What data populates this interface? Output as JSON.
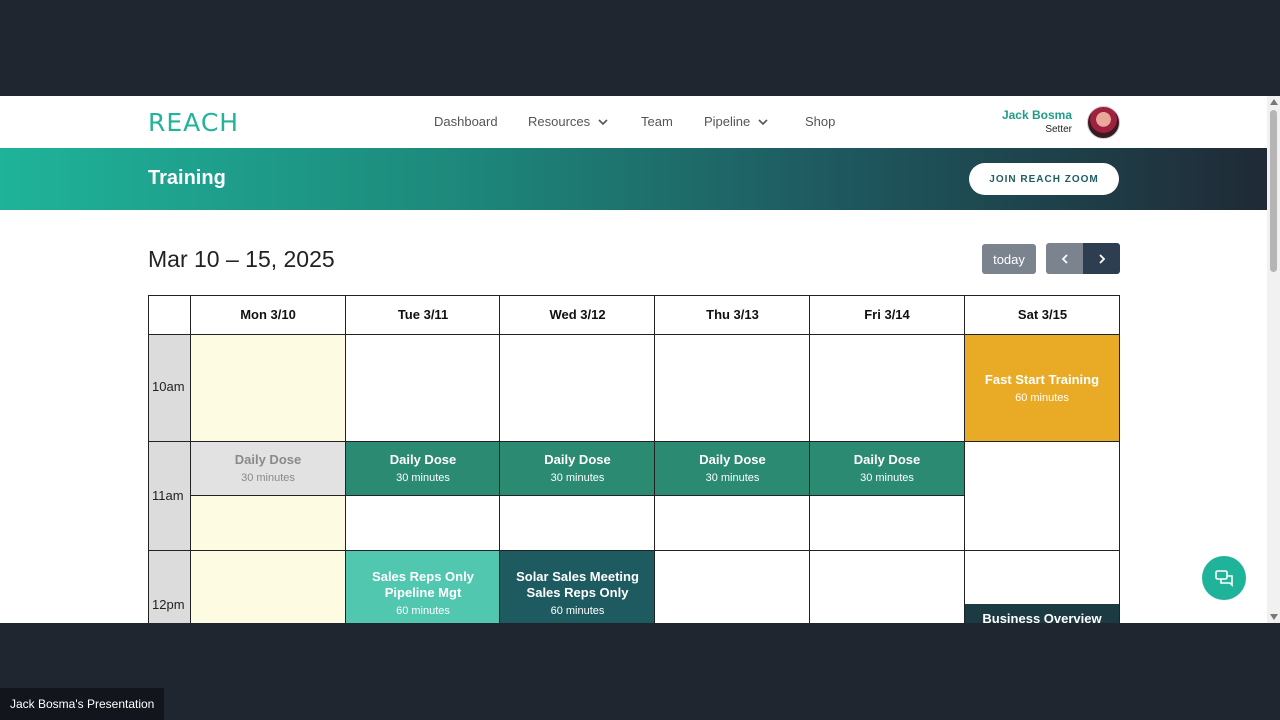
{
  "app": {
    "logo": "REACH",
    "nav": [
      "Dashboard",
      "Resources",
      "Team",
      "Pipeline",
      "Shop"
    ],
    "user": {
      "name": "Jack Bosma",
      "role": "Setter"
    }
  },
  "banner": {
    "title": "Training",
    "zoom_button": "JOIN REACH ZOOM"
  },
  "calendar": {
    "range": "Mar 10 – 15, 2025",
    "today_button": "today",
    "days": [
      "Mon 3/10",
      "Tue 3/11",
      "Wed 3/12",
      "Thu 3/13",
      "Fri 3/14",
      "Sat 3/15"
    ],
    "times": [
      "10am",
      "11am",
      "12pm"
    ],
    "events": {
      "fast_start": {
        "title": "Fast Start Training",
        "duration": "60 minutes"
      },
      "daily_dose": {
        "title": "Daily Dose",
        "duration": "30 minutes"
      },
      "sales_reps_pipeline": {
        "title_line1": "Sales Reps Only",
        "title_line2": "Pipeline Mgt",
        "duration": "60 minutes"
      },
      "solar_sales": {
        "title_line1": "Solar Sales Meeting",
        "title_line2": "Sales Reps Only",
        "duration": "60 minutes"
      },
      "business_overview": {
        "title": "Business Overview"
      }
    }
  },
  "presentation_label": "Jack Bosma's Presentation",
  "colors": {
    "accent": "#1fb39a",
    "daily_dose": "#2a8a72",
    "past_event": "#e2e2e2",
    "fast_start": "#e9ab25",
    "sales_reps": "#52c7b0",
    "solar": "#1e5b61",
    "overview": "#1c3a42"
  }
}
